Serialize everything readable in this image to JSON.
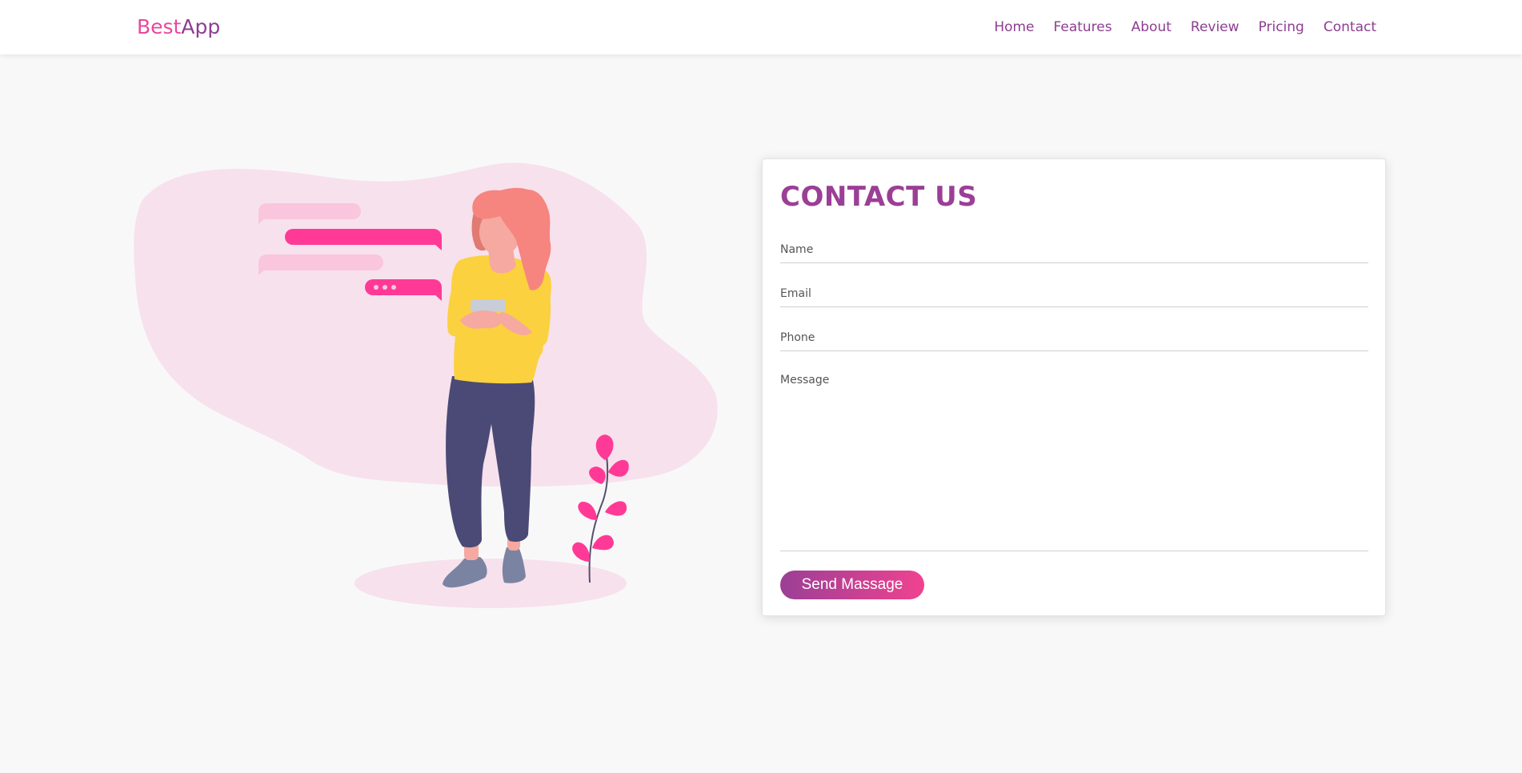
{
  "brand": {
    "part1": "Best",
    "part2": "App"
  },
  "nav": {
    "items": [
      {
        "label": "Home"
      },
      {
        "label": "Features"
      },
      {
        "label": "About"
      },
      {
        "label": "Review"
      },
      {
        "label": "Pricing"
      },
      {
        "label": "Contact"
      }
    ]
  },
  "contact": {
    "title": "CONTACT US",
    "name_placeholder": "Name",
    "email_placeholder": "Email",
    "phone_placeholder": "Phone",
    "message_placeholder": "Message",
    "submit_label": "Send Massage"
  },
  "colors": {
    "brand_pink": "#e8489d",
    "brand_purple": "#8e3d91",
    "blob": "#f7e1ec",
    "accent_pink": "#ff3a96",
    "light_pink": "#f9c6de",
    "shirt": "#fbd13f",
    "pants": "#4b4a76",
    "hair": "#f6847f"
  }
}
